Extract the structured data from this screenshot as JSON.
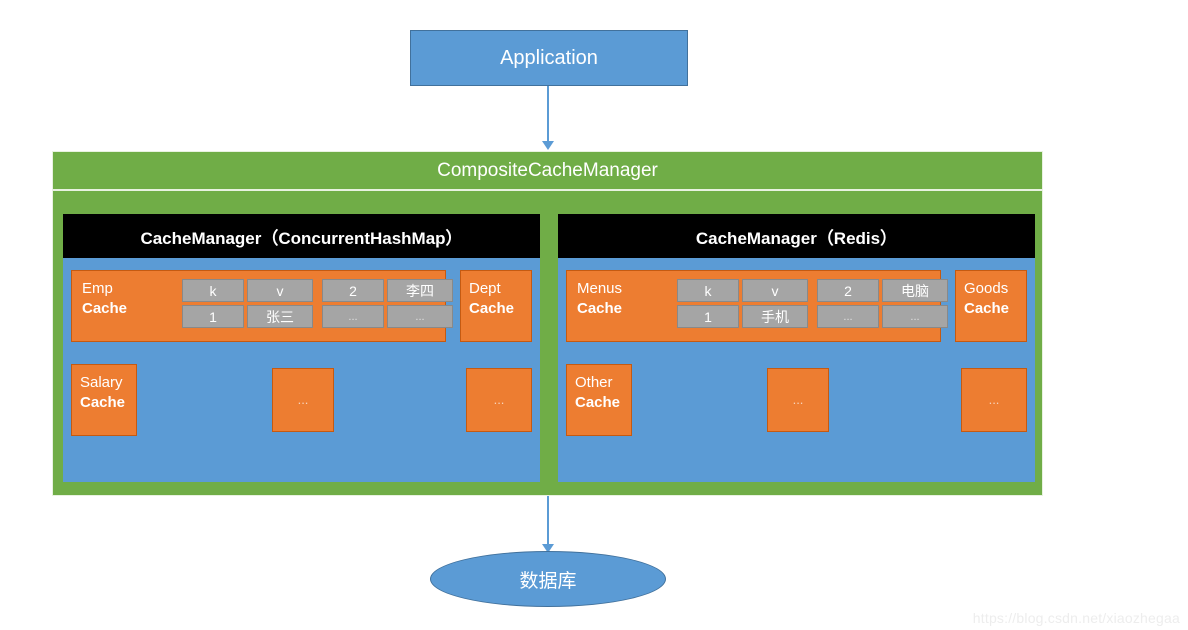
{
  "diagram": {
    "application": {
      "label": "Application"
    },
    "composite": {
      "title": "CompositeCacheManager"
    },
    "database": {
      "label": "数据库"
    },
    "watermark": "https://blog.csdn.net/xiaozhegaa",
    "colors": {
      "blue": "#5B9BD5",
      "green": "#70AD47",
      "orange": "#ED7D31",
      "gray": "#A5A5A5",
      "black": "#000000",
      "white": "#FFFFFF"
    },
    "managers": [
      {
        "header": "CacheManager（ConcurrentHashMap）",
        "row1": {
          "wide_cache": {
            "name": "Emp",
            "suffix": "Cache",
            "tables": [
              {
                "rows": [
                  [
                    "k",
                    "v"
                  ],
                  [
                    "1",
                    "张三"
                  ]
                ]
              },
              {
                "rows": [
                  [
                    "2",
                    "李四"
                  ],
                  [
                    "...",
                    "..."
                  ]
                ]
              }
            ]
          },
          "right_cache": {
            "name": "Dept",
            "suffix": "Cache"
          }
        },
        "row2": {
          "named_cache": {
            "name": "Salary",
            "suffix": "Cache"
          },
          "mid_cache": {
            "label": "..."
          },
          "right_cache": {
            "label": "..."
          }
        }
      },
      {
        "header": "CacheManager（Redis）",
        "row1": {
          "wide_cache": {
            "name": "Menus",
            "suffix": "Cache",
            "tables": [
              {
                "rows": [
                  [
                    "k",
                    "v"
                  ],
                  [
                    "1",
                    "手机"
                  ]
                ]
              },
              {
                "rows": [
                  [
                    "2",
                    "电脑"
                  ],
                  [
                    "...",
                    "..."
                  ]
                ]
              }
            ]
          },
          "right_cache": {
            "name": "Goods",
            "suffix": "Cache"
          }
        },
        "row2": {
          "named_cache": {
            "name": "Other",
            "suffix": "Cache"
          },
          "mid_cache": {
            "label": "..."
          },
          "right_cache": {
            "label": "..."
          }
        }
      }
    ]
  }
}
